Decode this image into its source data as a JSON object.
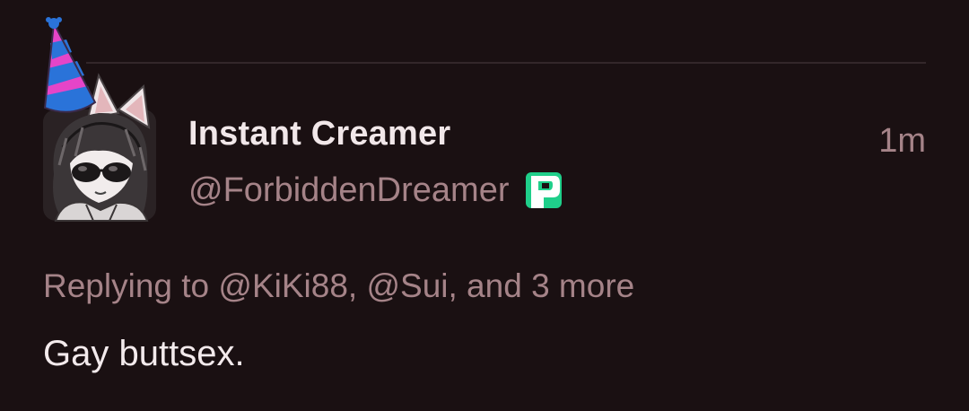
{
  "post": {
    "display_name": "Instant Creamer",
    "handle": "@ForbiddenDreamer",
    "timestamp": "1m",
    "reply_context": "Replying to @KiKi88, @Sui, and 3 more",
    "body": "Gay buttsex."
  },
  "icons": {
    "avatar": "avatar-party-hat-cat-ears",
    "badge": "p-badge-icon"
  },
  "colors": {
    "background": "#1a1012",
    "primary_text": "#f1e7e9",
    "secondary_text": "#a58388",
    "divider": "#33272a",
    "badge_green": "#1fcf8a"
  }
}
